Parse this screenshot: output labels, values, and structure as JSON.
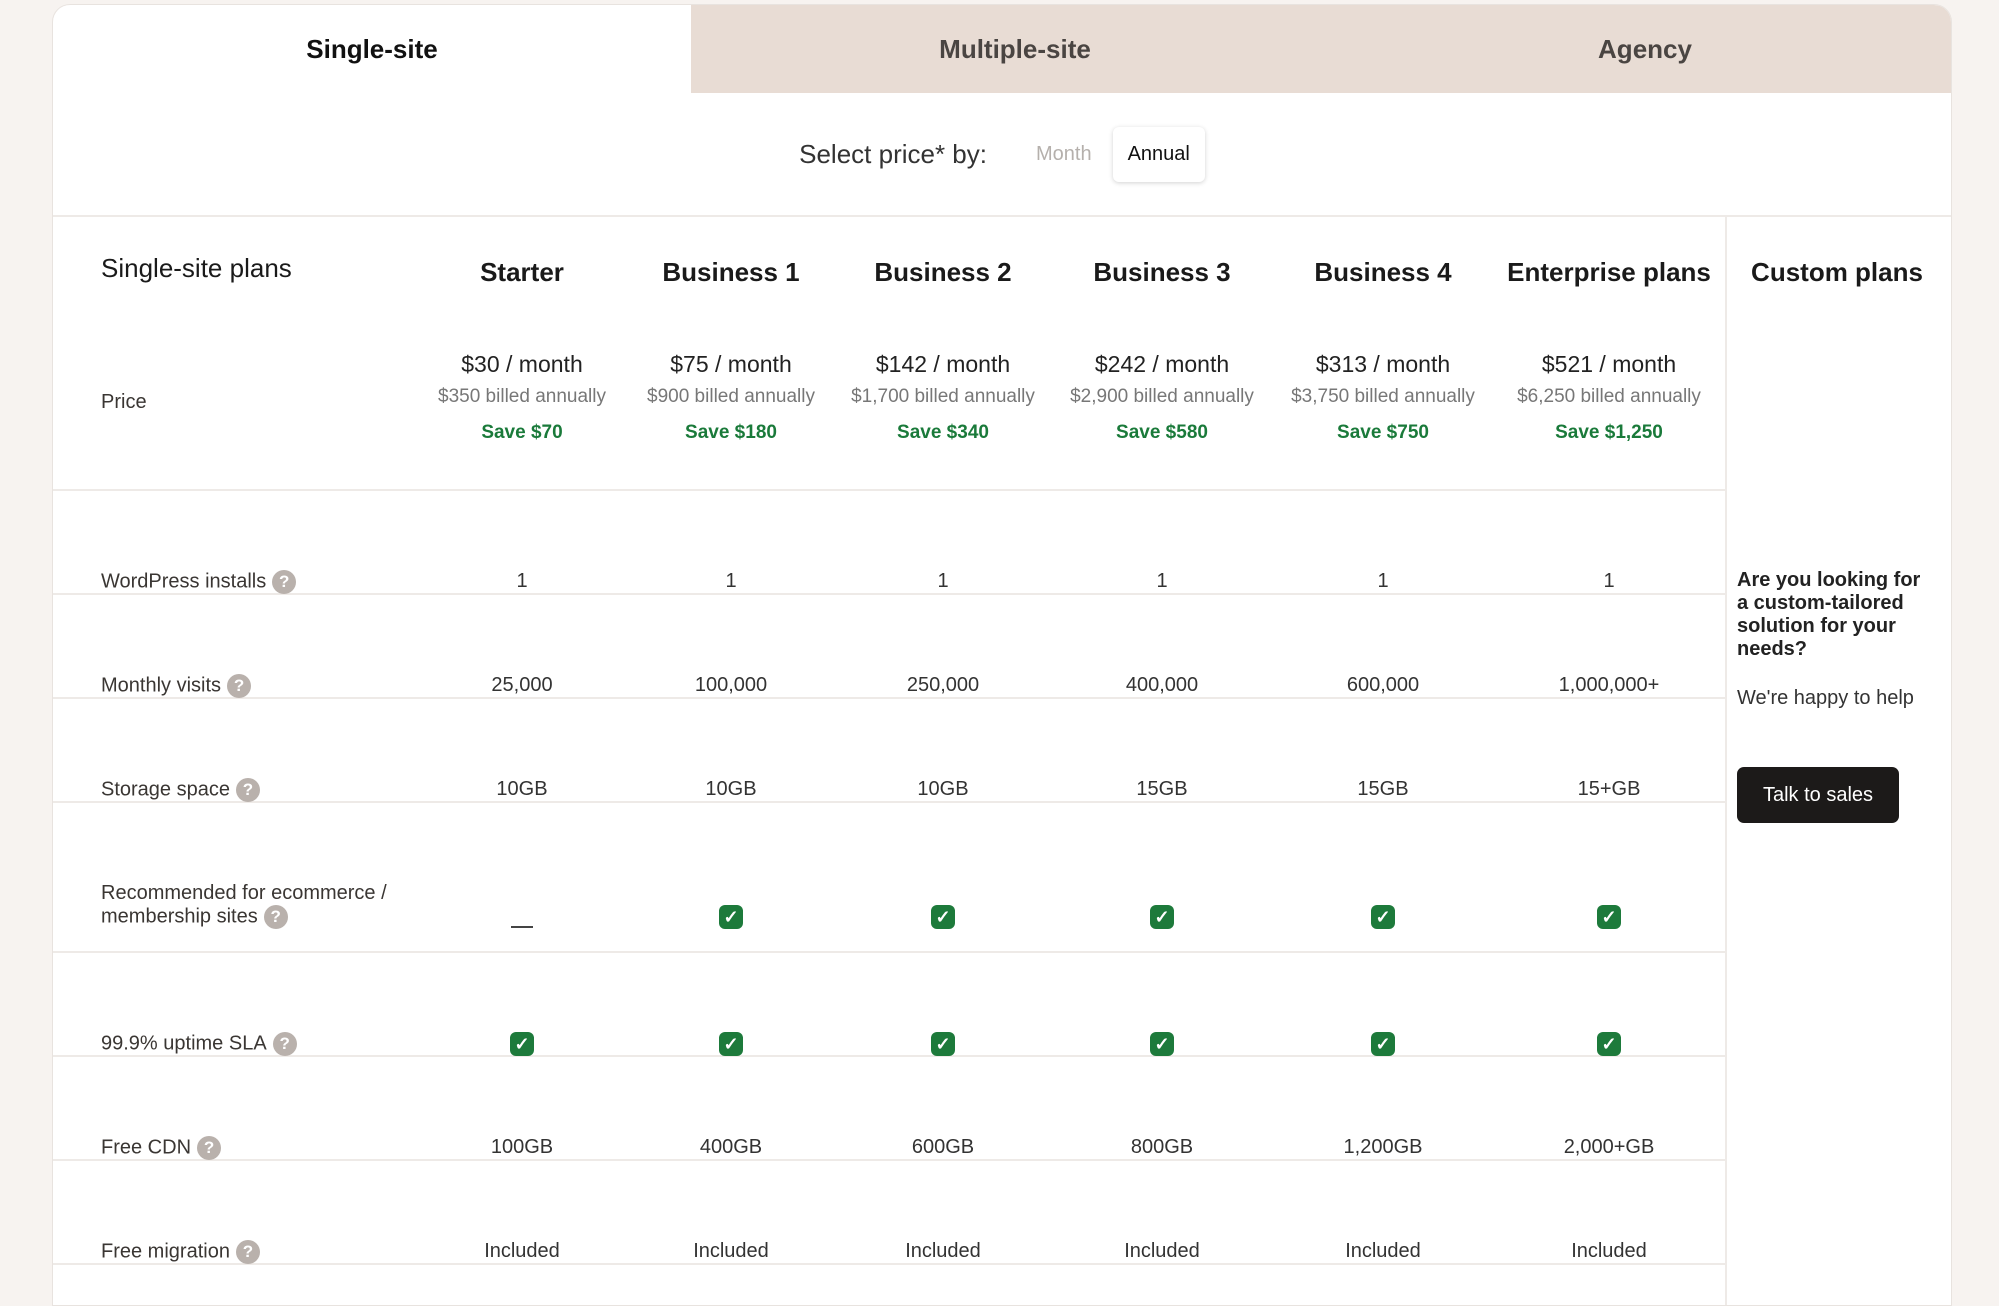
{
  "tabs": [
    "Single-site",
    "Multiple-site",
    "Agency"
  ],
  "price_selector": {
    "label": "Select price* by:",
    "options": [
      "Month",
      "Annual"
    ],
    "selected": "Annual"
  },
  "table": {
    "title": "Single-site plans",
    "plans": [
      "Starter",
      "Business 1",
      "Business 2",
      "Business 3",
      "Business 4",
      "Enterprise plans"
    ],
    "custom_title": "Custom plans",
    "price_label": "Price",
    "prices": [
      {
        "main": "$30 / month",
        "sub": "$350 billed annually",
        "save": "Save $70"
      },
      {
        "main": "$75 / month",
        "sub": "$900 billed annually",
        "save": "Save $180"
      },
      {
        "main": "$142 / month",
        "sub": "$1,700 billed annually",
        "save": "Save $340"
      },
      {
        "main": "$242 / month",
        "sub": "$2,900 billed annually",
        "save": "Save $580"
      },
      {
        "main": "$313 / month",
        "sub": "$3,750 billed annually",
        "save": "Save $750"
      },
      {
        "main": "$521 / month",
        "sub": "$6,250 billed annually",
        "save": "Save $1,250"
      }
    ],
    "rows": [
      {
        "label": "WordPress installs",
        "type": "text",
        "values": [
          "1",
          "1",
          "1",
          "1",
          "1",
          "1"
        ]
      },
      {
        "label": "Monthly visits",
        "type": "text",
        "values": [
          "25,000",
          "100,000",
          "250,000",
          "400,000",
          "600,000",
          "1,000,000+"
        ]
      },
      {
        "label": "Storage space",
        "type": "text",
        "values": [
          "10GB",
          "10GB",
          "10GB",
          "15GB",
          "15GB",
          "15+GB"
        ]
      },
      {
        "label": "Recommended for ecommerce / membership sites",
        "type": "check",
        "values": [
          false,
          true,
          true,
          true,
          true,
          true
        ]
      },
      {
        "label": "99.9% uptime SLA",
        "type": "check",
        "values": [
          true,
          true,
          true,
          true,
          true,
          true
        ]
      },
      {
        "label": "Free CDN",
        "type": "text",
        "values": [
          "100GB",
          "400GB",
          "600GB",
          "800GB",
          "1,200GB",
          "2,000+GB"
        ]
      },
      {
        "label": "Free migration",
        "type": "text",
        "values": [
          "Included",
          "Included",
          "Included",
          "Included",
          "Included",
          "Included"
        ]
      }
    ]
  },
  "custom": {
    "question": "Are you looking for a custom-tailored solution for your needs?",
    "help_text": "We're happy to help",
    "button": "Talk to sales"
  },
  "icons": {
    "help": "question-circle-icon",
    "check": "checkbox-checked-icon",
    "dash": "dash-icon"
  },
  "colors": {
    "accent_green": "#1d7a3b",
    "tab_bg": "#e8dcd4",
    "button_bg": "#1c1a19"
  }
}
